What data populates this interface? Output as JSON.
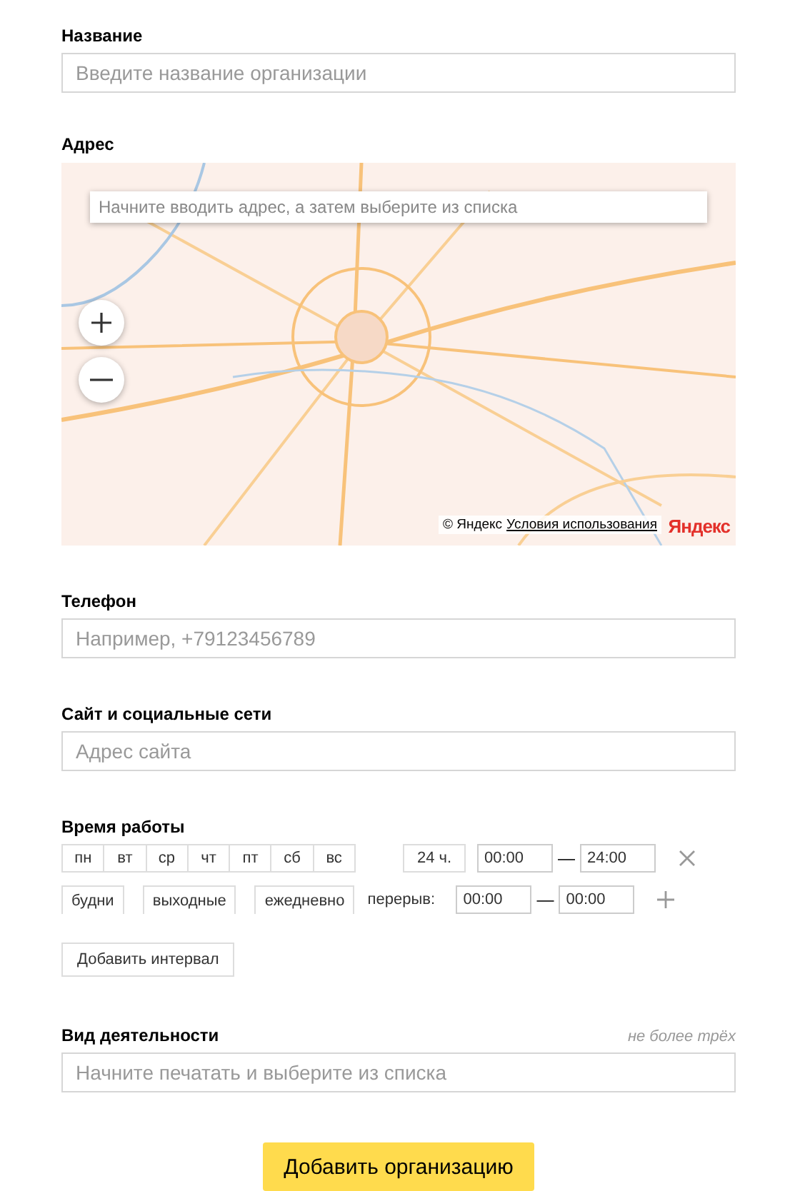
{
  "name": {
    "label": "Название",
    "placeholder": "Введите название организации"
  },
  "address": {
    "label": "Адрес",
    "search_placeholder": "Начните вводить адрес, а затем выберите из списка",
    "copyright": "© Яндекс",
    "terms_link": "Условия использования",
    "logo": "Яндекс"
  },
  "phone": {
    "label": "Телефон",
    "placeholder": "Например, +79123456789"
  },
  "site": {
    "label": "Сайт и социальные сети",
    "placeholder": "Адрес сайта"
  },
  "hours": {
    "label": "Время работы",
    "days": [
      {
        "label": "пн",
        "selected": false
      },
      {
        "label": "вт",
        "selected": false
      },
      {
        "label": "ср",
        "selected": false
      },
      {
        "label": "чт",
        "selected": false
      },
      {
        "label": "пт",
        "selected": false
      },
      {
        "label": "сб",
        "selected": false
      },
      {
        "label": "вс",
        "selected": false
      }
    ],
    "all_day": {
      "label": "24 ч.",
      "selected": false
    },
    "work": {
      "from": "00:00",
      "separator": "—",
      "to": "24:00"
    },
    "presets": [
      {
        "label": "будни",
        "selected": false
      },
      {
        "label": "выходные",
        "selected": false
      },
      {
        "label": "ежедневно",
        "selected": false
      }
    ],
    "break": {
      "label": "перерыв:",
      "from": "00:00",
      "separator": "—",
      "to": "00:00"
    },
    "add_interval": "Добавить интервал"
  },
  "activity": {
    "label": "Вид деятельности",
    "hint": "не более трёх",
    "placeholder": "Начните печатать и выберите из списка"
  },
  "submit": "Добавить организацию"
}
